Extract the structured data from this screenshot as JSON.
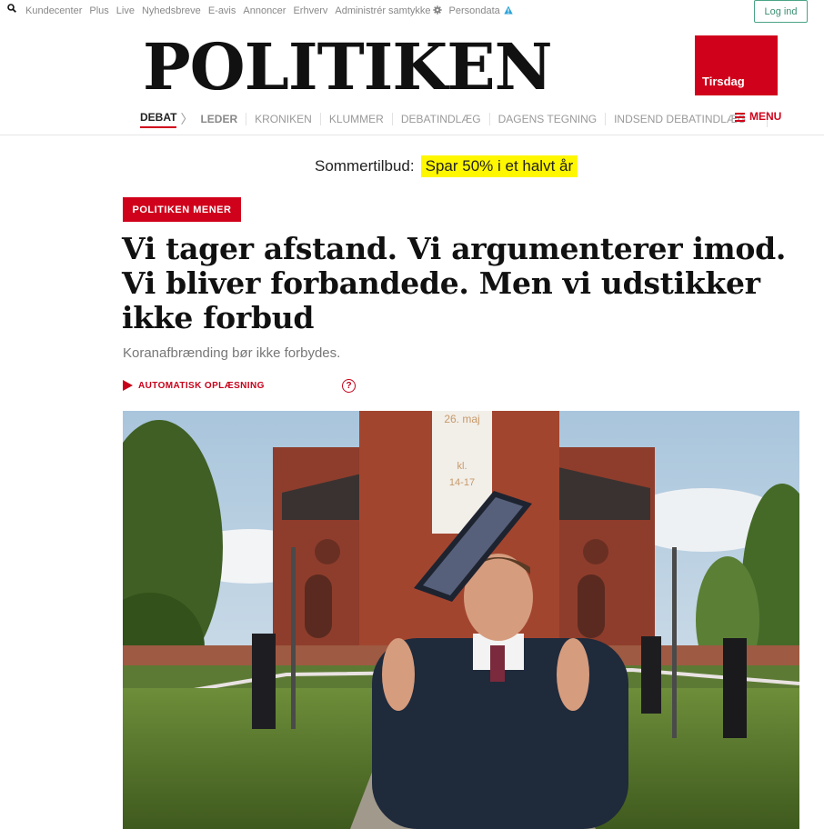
{
  "topbar": {
    "links": [
      "Kundecenter",
      "Plus",
      "Live",
      "Nyhedsbreve",
      "E-avis",
      "Annoncer",
      "Erhverv",
      "Administrér samtykke",
      "Persondata"
    ],
    "login_label": "Log ind"
  },
  "masthead": {
    "logo": "POLITIKEN",
    "day": "Tirsdag"
  },
  "nav": {
    "section": "DEBAT",
    "items": [
      "LEDER",
      "KRONIKEN",
      "KLUMMER",
      "DEBATINDLÆG",
      "DAGENS TEGNING",
      "INDSEND DEBATINDLÆG"
    ],
    "menu_label": "MENU"
  },
  "promo": {
    "label": "Sommertilbud:",
    "highlight": "Spar 50% i et halvt år"
  },
  "article": {
    "tag": "POLITIKEN MENER",
    "headline": "Vi tager afstand. Vi argumenterer imod. Vi bliver forbandede. Men vi udstikker ikke forbud",
    "subheadline": "Koranafbrænding bør ikke forbydes.",
    "listen_label": "AUTOMATISK OPLÆSNING",
    "help_label": "?"
  },
  "photo": {
    "banner_date": "26. maj",
    "banner_time_label": "kl.",
    "banner_time": "14-17"
  },
  "colors": {
    "brand_red": "#d0021b",
    "highlight": "#fff700",
    "login_green": "#3b8f74"
  }
}
